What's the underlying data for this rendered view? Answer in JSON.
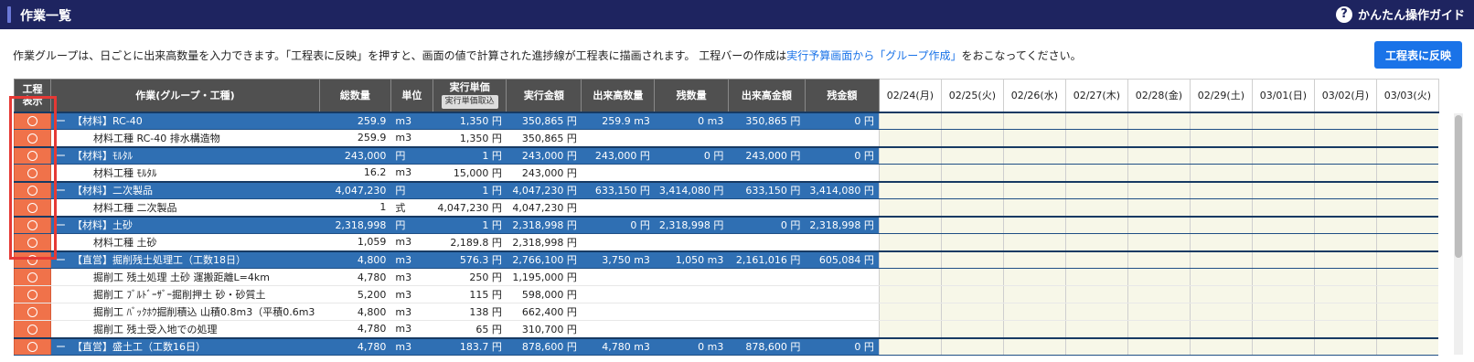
{
  "header": {
    "title": "作業一覧",
    "guide_label": "かんたん操作ガイド",
    "guide_icon": "?"
  },
  "description": {
    "before": "作業グループは、日ごとに出来高数量を入力できます。「工程表に反映」を押すと、画面の値で計算された進捗線が工程表に描画されます。 工程バーの作成は",
    "link": "実行予算画面から「グループ作成」",
    "after": "をおこなってください。"
  },
  "reflect_button": "工程表に反映",
  "columns": {
    "display_top": "工程",
    "display_bottom": "表示",
    "work": "作業(グループ・工種)",
    "total_qty": "総数量",
    "unit": "単位",
    "unit_price": "実行単価",
    "unit_price_import": "実行単価取込",
    "amount": "実行金額",
    "done_qty": "出来高数量",
    "remaining_qty": "残数量",
    "done_amount": "出来高金額",
    "remaining_amount": "残金額"
  },
  "dates": [
    "02/24(月)",
    "02/25(火)",
    "02/26(水)",
    "02/27(木)",
    "02/28(金)",
    "02/29(土)",
    "03/01(日)",
    "03/02(月)",
    "03/03(火)"
  ],
  "groups": [
    {
      "toggle": "ー",
      "name": "【材料】RC-40",
      "total": "259.9",
      "unit": "m3",
      "price": "1,350 円",
      "amount": "350,865 円",
      "done": "259.9 m3",
      "remaining": "0 m3",
      "done_amount": "350,865 円",
      "remaining_amount": "0 円",
      "children": [
        {
          "name": "材料工種 RC-40 排水構造物",
          "total": "259.9",
          "unit": "m3",
          "price": "1,350 円",
          "amount": "350,865 円"
        }
      ]
    },
    {
      "toggle": "ー",
      "name": "【材料】ﾓﾙﾀﾙ",
      "total": "243,000",
      "unit": "円",
      "price": "1 円",
      "amount": "243,000 円",
      "done": "243,000 円",
      "remaining": "0 円",
      "done_amount": "243,000 円",
      "remaining_amount": "0 円",
      "children": [
        {
          "name": "材料工種 ﾓﾙﾀﾙ",
          "total": "16.2",
          "unit": "m3",
          "price": "15,000 円",
          "amount": "243,000 円"
        }
      ]
    },
    {
      "toggle": "ー",
      "name": "【材料】二次製品",
      "total": "4,047,230",
      "unit": "円",
      "price": "1 円",
      "amount": "4,047,230 円",
      "done": "633,150 円",
      "remaining": "3,414,080 円",
      "done_amount": "633,150 円",
      "remaining_amount": "3,414,080 円",
      "children": [
        {
          "name": "材料工種 二次製品",
          "total": "1",
          "unit": "式",
          "price": "4,047,230 円",
          "amount": "4,047,230 円"
        }
      ]
    },
    {
      "toggle": "ー",
      "name": "【材料】土砂",
      "total": "2,318,998",
      "unit": "円",
      "price": "1 円",
      "amount": "2,318,998 円",
      "done": "0 円",
      "remaining": "2,318,998 円",
      "done_amount": "0 円",
      "remaining_amount": "2,318,998 円",
      "children": [
        {
          "name": "材料工種 土砂",
          "total": "1,059",
          "unit": "m3",
          "price": "2,189.8 円",
          "amount": "2,318,998 円"
        }
      ]
    },
    {
      "toggle": "ー",
      "name": "【直営】掘削残土処理工（工数18日）",
      "total": "4,800",
      "unit": "m3",
      "price": "576.3 円",
      "amount": "2,766,100 円",
      "done": "3,750 m3",
      "remaining": "1,050 m3",
      "done_amount": "2,161,016 円",
      "remaining_amount": "605,084 円",
      "children": [
        {
          "name": "掘削工 残土処理 土砂 運搬距離L=4km",
          "total": "4,780",
          "unit": "m3",
          "price": "250 円",
          "amount": "1,195,000 円"
        },
        {
          "name": "掘削工 ﾌﾞﾙﾄﾞｰｻﾞｰ掘削押土 砂・砂質土",
          "total": "5,200",
          "unit": "m3",
          "price": "115 円",
          "amount": "598,000 円"
        },
        {
          "name": "掘削工 ﾊﾞｯｸﾎｳ掘削積込 山積0.8m3（平積0.6m3",
          "total": "4,800",
          "unit": "m3",
          "price": "138 円",
          "amount": "662,400 円"
        },
        {
          "name": "掘削工 残土受入地での処理",
          "total": "4,780",
          "unit": "m3",
          "price": "65 円",
          "amount": "310,700 円"
        }
      ]
    },
    {
      "toggle": "ー",
      "name": "【直営】盛土工（工数16日）",
      "total": "4,780",
      "unit": "m3",
      "price": "183.7 円",
      "amount": "878,600 円",
      "done": "4,780 m3",
      "remaining": "0 m3",
      "done_amount": "878,600 円",
      "remaining_amount": "0 円",
      "children": []
    }
  ]
}
